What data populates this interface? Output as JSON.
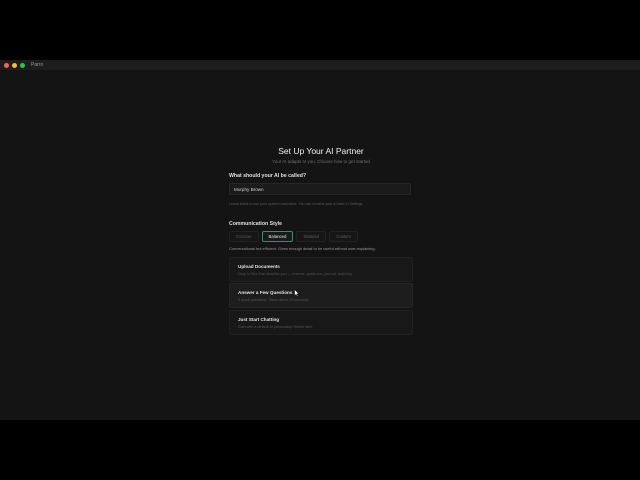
{
  "window": {
    "app_name": "Parro"
  },
  "header": {
    "title": "Set Up Your AI Partner",
    "subtitle": "Your AI adapts to you. Choose how to get started"
  },
  "name_section": {
    "label": "What should your AI be called?",
    "value": "Murphy Brown",
    "help": "Leave blank to use your system username. You can rename your AI later in Settings."
  },
  "style_section": {
    "label": "Communication Style",
    "options": [
      "Concise",
      "Balanced",
      "Detailed",
      "Custom"
    ],
    "selected": "Balanced",
    "description": "Conversational but efficient. Gives enough detail to be useful without over-explaining."
  },
  "start_options": [
    {
      "title": "Upload Documents",
      "description": "Drop in files that describe you — resume, goals doc, journal, anything."
    },
    {
      "title": "Answer a Few Questions",
      "description": "5 quick questions. Takes about 30 seconds."
    },
    {
      "title": "Just Start Chatting",
      "description": "Start with a default AI personality. Refine later."
    }
  ],
  "colors": {
    "accent": "#3a8a78",
    "background": "#141414"
  }
}
